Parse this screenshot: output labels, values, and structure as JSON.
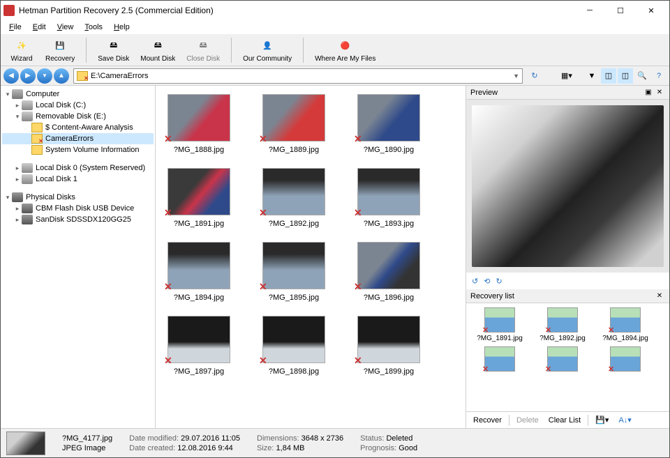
{
  "window": {
    "title": "Hetman Partition Recovery 2.5 (Commercial Edition)"
  },
  "menu": {
    "file": "File",
    "edit": "Edit",
    "view": "View",
    "tools": "Tools",
    "help": "Help"
  },
  "toolbar": {
    "wizard": "Wizard",
    "recovery": "Recovery",
    "save_disk": "Save Disk",
    "mount_disk": "Mount Disk",
    "close_disk": "Close Disk",
    "community": "Our Community",
    "where": "Where Are My Files"
  },
  "nav": {
    "path": "E:\\CameraErrors"
  },
  "tree": {
    "computer": "Computer",
    "local_c": "Local Disk (C:)",
    "removable_e": "Removable Disk (E:)",
    "content_aware": "$ Content-Aware Analysis",
    "camera_errors": "CameraErrors",
    "sys_vol_info": "System Volume Information",
    "local_0": "Local Disk 0 (System Reserved)",
    "local_1": "Local Disk 1",
    "physical": "Physical Disks",
    "cbm": "CBM Flash Disk USB Device",
    "sandisk": "SanDisk SDSSDX120GG25"
  },
  "files": [
    {
      "name": "?MG_1888.jpg"
    },
    {
      "name": "?MG_1889.jpg"
    },
    {
      "name": "?MG_1890.jpg"
    },
    {
      "name": "?MG_1891.jpg"
    },
    {
      "name": "?MG_1892.jpg"
    },
    {
      "name": "?MG_1893.jpg"
    },
    {
      "name": "?MG_1894.jpg"
    },
    {
      "name": "?MG_1895.jpg"
    },
    {
      "name": "?MG_1896.jpg"
    },
    {
      "name": "?MG_1897.jpg"
    },
    {
      "name": "?MG_1898.jpg"
    },
    {
      "name": "?MG_1899.jpg"
    }
  ],
  "preview": {
    "title": "Preview"
  },
  "recovery_list": {
    "title": "Recovery list",
    "items": [
      {
        "name": "?MG_1891.jpg"
      },
      {
        "name": "?MG_1892.jpg"
      },
      {
        "name": "?MG_1894.jpg"
      },
      {
        "name": ""
      },
      {
        "name": ""
      },
      {
        "name": ""
      }
    ],
    "recover": "Recover",
    "delete": "Delete",
    "clear": "Clear List"
  },
  "status": {
    "filename": "?MG_4177.jpg",
    "filetype": "JPEG Image",
    "date_modified_label": "Date modified:",
    "date_modified": "29.07.2016 11:05",
    "date_created_label": "Date created:",
    "date_created": "12.08.2016 9:44",
    "dimensions_label": "Dimensions:",
    "dimensions": "3648 x 2736",
    "size_label": "Size:",
    "size": "1,84 MB",
    "status_label": "Status:",
    "status": "Deleted",
    "prognosis_label": "Prognosis:",
    "prognosis": "Good"
  }
}
